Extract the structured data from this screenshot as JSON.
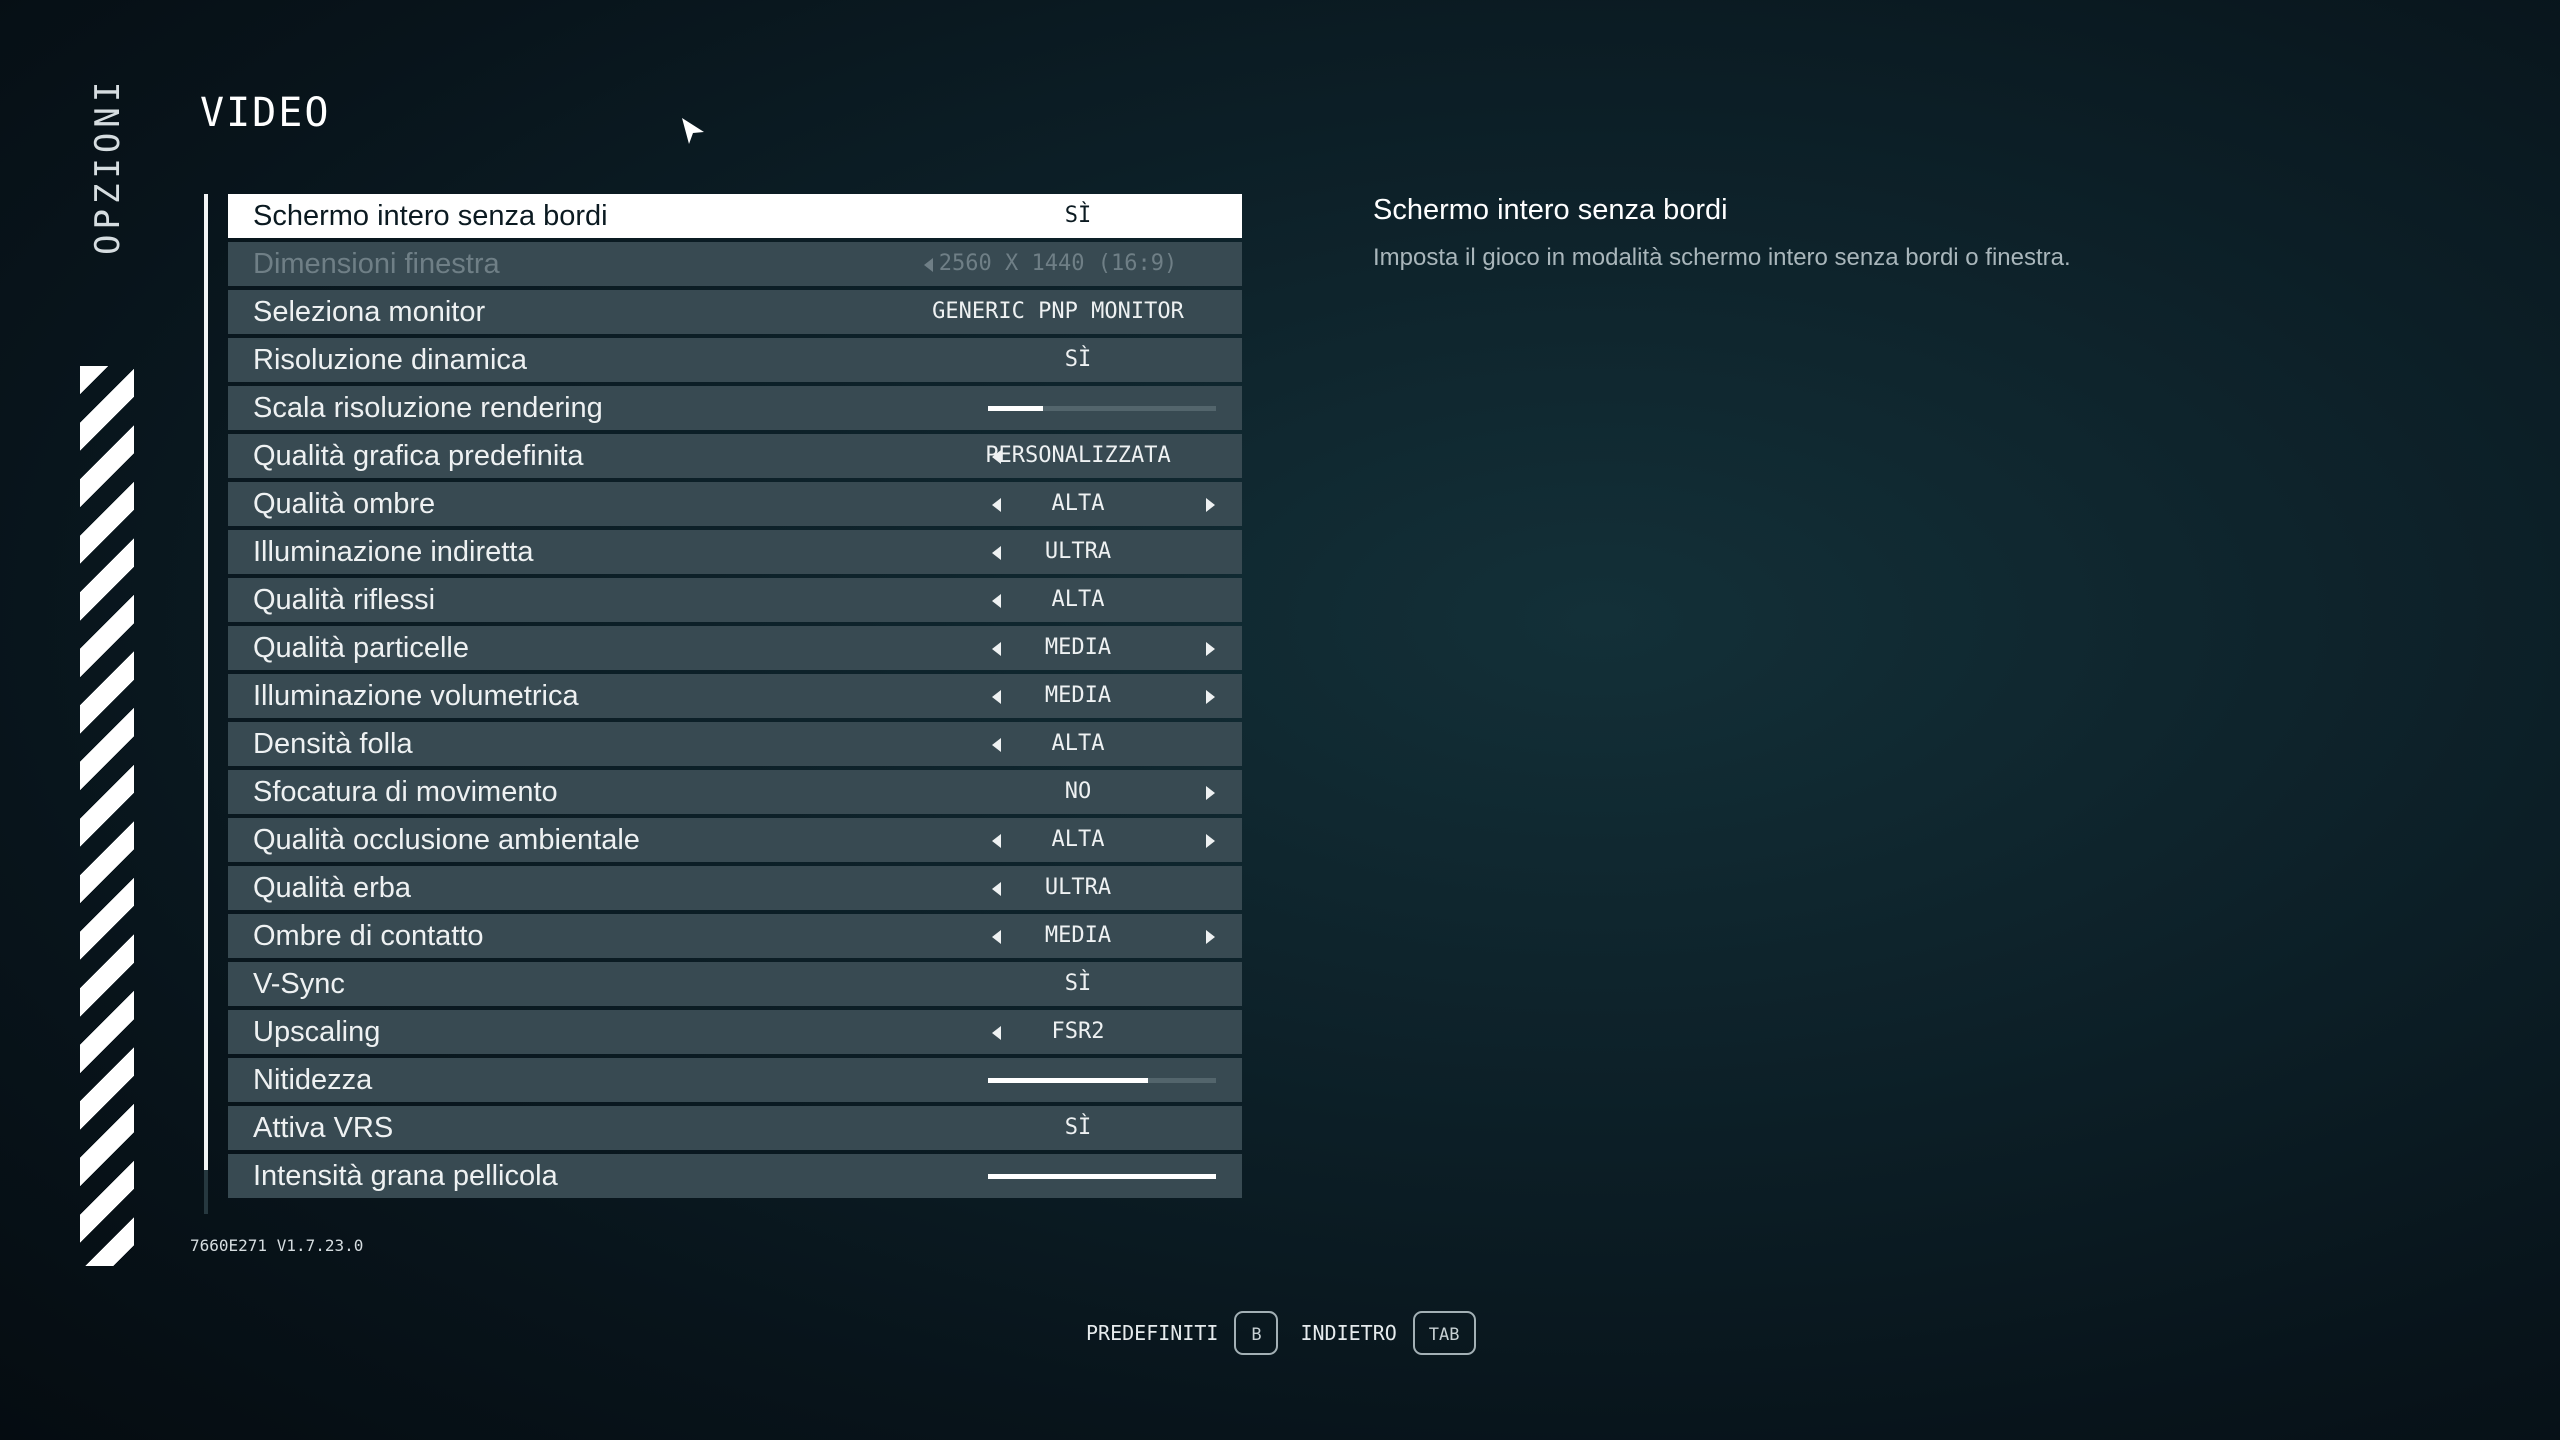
{
  "sidebar": {
    "title": "OPZIONI"
  },
  "page": {
    "title": "VIDEO"
  },
  "settings": [
    {
      "label": "Schermo intero senza bordi",
      "value": "SÌ",
      "control": "toggle",
      "state": "selected"
    },
    {
      "label": "Dimensioni finestra",
      "value": "2560 X 1440 (16:9)",
      "control": "select",
      "state": "disabled",
      "left": true,
      "right": false
    },
    {
      "label": "Seleziona monitor",
      "value": "GENERIC PNP MONITOR",
      "control": "select",
      "left": false,
      "right": false
    },
    {
      "label": "Risoluzione dinamica",
      "value": "SÌ",
      "control": "toggle"
    },
    {
      "label": "Scala risoluzione rendering",
      "control": "slider",
      "level": 0.24
    },
    {
      "label": "Qualità grafica predefinita",
      "value": "PERSONALIZZATA",
      "control": "select",
      "left": true,
      "right": false
    },
    {
      "label": "Qualità ombre",
      "value": "ALTA",
      "control": "select",
      "left": true,
      "right": true
    },
    {
      "label": "Illuminazione indiretta",
      "value": "ULTRA",
      "control": "select",
      "left": true,
      "right": false
    },
    {
      "label": "Qualità riflessi",
      "value": "ALTA",
      "control": "select",
      "left": true,
      "right": false
    },
    {
      "label": "Qualità particelle",
      "value": "MEDIA",
      "control": "select",
      "left": true,
      "right": true
    },
    {
      "label": "Illuminazione volumetrica",
      "value": "MEDIA",
      "control": "select",
      "left": true,
      "right": true
    },
    {
      "label": "Densità folla",
      "value": "ALTA",
      "control": "select",
      "left": true,
      "right": false
    },
    {
      "label": "Sfocatura di movimento",
      "value": "NO",
      "control": "select",
      "left": false,
      "right": true
    },
    {
      "label": "Qualità occlusione ambientale",
      "value": "ALTA",
      "control": "select",
      "left": true,
      "right": true
    },
    {
      "label": "Qualità erba",
      "value": "ULTRA",
      "control": "select",
      "left": true,
      "right": false
    },
    {
      "label": "Ombre di contatto",
      "value": "MEDIA",
      "control": "select",
      "left": true,
      "right": true
    },
    {
      "label": "V-Sync",
      "value": "SÌ",
      "control": "toggle"
    },
    {
      "label": "Upscaling",
      "value": "FSR2",
      "control": "select",
      "left": true,
      "right": false
    },
    {
      "label": "Nitidezza",
      "control": "slider",
      "level": 0.7
    },
    {
      "label": "Attiva VRS",
      "value": "SÌ",
      "control": "toggle"
    },
    {
      "label": "Intensità grana pellicola",
      "control": "slider",
      "level": 1.0
    }
  ],
  "description": {
    "title": "Schermo intero senza bordi",
    "text": "Imposta il gioco in modalità schermo intero senza bordi o finestra."
  },
  "version": "7660E271 V1.7.23.0",
  "footer": {
    "defaults_label": "PREDEFINITI",
    "defaults_key": "B",
    "back_label": "INDIETRO",
    "back_key": "TAB"
  },
  "colors": {
    "accent": "#ffffff",
    "row_bg": "#384a52",
    "background": "#0d2129"
  }
}
